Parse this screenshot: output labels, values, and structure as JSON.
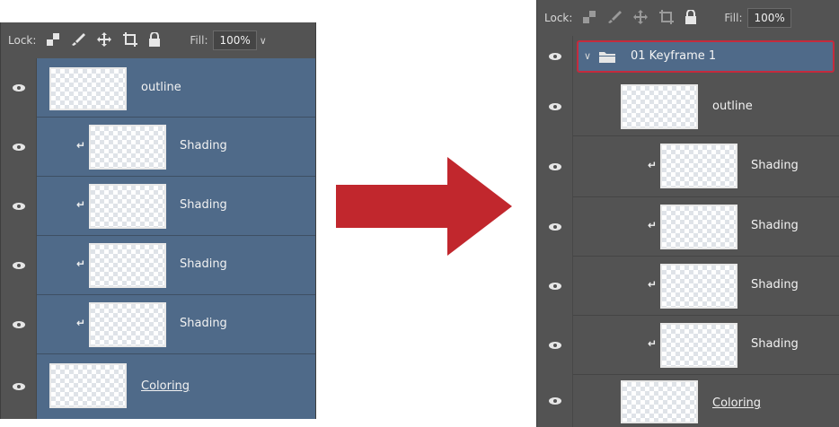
{
  "left": {
    "lock_label": "Lock:",
    "fill_label": "Fill:",
    "fill_value": "100%",
    "layers": [
      {
        "name": "outline",
        "clipped": false
      },
      {
        "name": "Shading",
        "clipped": true
      },
      {
        "name": "Shading",
        "clipped": true
      },
      {
        "name": "Shading",
        "clipped": true
      },
      {
        "name": "Shading",
        "clipped": true
      },
      {
        "name": "Coloring",
        "clipped": false
      }
    ]
  },
  "right": {
    "lock_label": "Lock:",
    "fill_label": "Fill:",
    "fill_value": "100%",
    "group": {
      "name": "01 Keyframe 1",
      "expanded": true
    },
    "layers": [
      {
        "name": "outline",
        "clipped": false
      },
      {
        "name": "Shading",
        "clipped": true
      },
      {
        "name": "Shading",
        "clipped": true
      },
      {
        "name": "Shading",
        "clipped": true
      },
      {
        "name": "Shading",
        "clipped": true
      },
      {
        "name": "Coloring",
        "clipped": false
      }
    ]
  },
  "colors": {
    "panel_bg": "#535353",
    "selected_layer": "#4f6a89",
    "group_highlight_border": "#c42b3d",
    "arrow": "#c1272d"
  },
  "icons": [
    "eye-icon",
    "lock-transparent-icon",
    "brush-icon",
    "move-icon",
    "artboard-icon",
    "lock-icon",
    "folder-icon",
    "clip-arrow-icon",
    "chevron-down-icon",
    "arrow-right-icon"
  ]
}
